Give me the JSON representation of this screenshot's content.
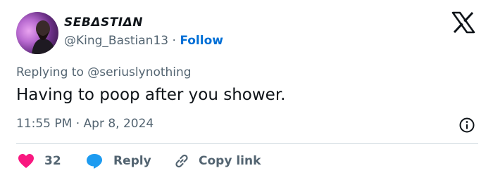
{
  "author": {
    "display_name": "SEBΔSTIΔN",
    "handle": "@King_Bastian13",
    "separator": "·",
    "follow_label": "Follow"
  },
  "reply_context": {
    "text": "Replying to @seriuslynothing"
  },
  "tweet": {
    "text": "Having to poop after you shower."
  },
  "meta": {
    "timestamp": "11:55 PM · Apr 8, 2024"
  },
  "actions": {
    "like_count": "32",
    "reply_label": "Reply",
    "copy_link_label": "Copy link"
  },
  "colors": {
    "like": "#f91880",
    "reply": "#1d9bf0",
    "link": "#006fd6",
    "muted": "#536471"
  },
  "icons": [
    "x-logo-icon",
    "heart-icon",
    "reply-bubble-icon",
    "link-icon",
    "info-icon"
  ]
}
